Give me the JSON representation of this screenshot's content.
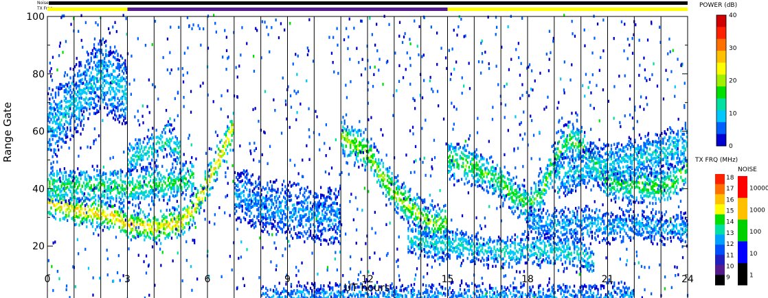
{
  "chart_data": {
    "type": "heatmap",
    "xlabel": "UT hours",
    "ylabel": "Range Gate",
    "xlim": [
      0,
      24
    ],
    "ylim": [
      0,
      100
    ],
    "x_ticks": [
      "0",
      "3",
      "6",
      "9",
      "12",
      "15",
      "18",
      "21",
      "24"
    ],
    "y_ticks": [
      "0",
      "20",
      "40",
      "60",
      "80",
      "100"
    ],
    "vertical_gridlines_hours": [
      1,
      2,
      3,
      4,
      5,
      6,
      7,
      8,
      9,
      10,
      11,
      12,
      13,
      14,
      15,
      16,
      17,
      18,
      19,
      20,
      21,
      22,
      23
    ],
    "noise_label": "Noise",
    "txfreq_label": "TX Freq",
    "tx_freq_segments": [
      {
        "start": 0,
        "end": 3,
        "color": "#ffff00"
      },
      {
        "start": 3,
        "end": 15,
        "color": "#551a8b"
      },
      {
        "start": 15,
        "end": 24,
        "color": "#ffff00"
      }
    ],
    "power_scale": {
      "title": "POWER (dB)",
      "ticks": [
        "40",
        "30",
        "20",
        "10",
        "0"
      ],
      "range": [
        0,
        40
      ],
      "colors": [
        "#0000d0",
        "#0060ff",
        "#00c8ff",
        "#00e0a0",
        "#00e000",
        "#a0f000",
        "#ffff00",
        "#ffc000",
        "#ff7000",
        "#ff2000",
        "#d00000"
      ]
    },
    "tx_freq_scale": {
      "title": "TX FRQ (MHz)",
      "ticks": [
        "18",
        "17",
        "16",
        "15",
        "14",
        "13",
        "12",
        "11",
        "10",
        "9"
      ],
      "colors": [
        "#000000",
        "#551a8b",
        "#2020c0",
        "#0050ff",
        "#00a0ff",
        "#00e0a0",
        "#00e000",
        "#ffff00",
        "#ffc000",
        "#ff7000",
        "#ff2000"
      ]
    },
    "noise_scale": {
      "title": "NOISE",
      "ticks": [
        "10000",
        "1000",
        "100",
        "10",
        "1"
      ],
      "colors": [
        "#000000",
        "#0000ff",
        "#00d000",
        "#ffc000",
        "#ff0000"
      ]
    },
    "echo_bands": [
      {
        "name": "",
        "points": [
          [
            0,
            35
          ],
          [
            1,
            32
          ],
          [
            2,
            31
          ],
          [
            2.5,
            30
          ],
          [
            3,
            27
          ],
          [
            4,
            26
          ],
          [
            5,
            28
          ],
          [
            5.5,
            33
          ],
          [
            6,
            42
          ],
          [
            6.5,
            52
          ],
          [
            7,
            62
          ]
        ],
        "power": 24,
        "width": 5
      },
      {
        "name": "",
        "points": [
          [
            0,
            41
          ],
          [
            2,
            40
          ],
          [
            3,
            40
          ],
          [
            4,
            41
          ],
          [
            5,
            42
          ],
          [
            5.5,
            44
          ]
        ],
        "power": 14,
        "width": 6
      },
      {
        "name": "",
        "points": [
          [
            3,
            50
          ],
          [
            4,
            54
          ],
          [
            4.5,
            57
          ],
          [
            5,
            52
          ]
        ],
        "power": 11,
        "width": 5
      },
      {
        "name": "",
        "points": [
          [
            7,
            38
          ],
          [
            8,
            34
          ],
          [
            9,
            32
          ],
          [
            10,
            30
          ],
          [
            11,
            30
          ]
        ],
        "power": 6,
        "width": 9
      },
      {
        "name": "",
        "points": [
          [
            11,
            58
          ],
          [
            12,
            52
          ],
          [
            12.5,
            44
          ],
          [
            13,
            38
          ],
          [
            13.5,
            34
          ],
          [
            14,
            30
          ],
          [
            14.5,
            27
          ],
          [
            15,
            28
          ]
        ],
        "power": 18,
        "width": 6
      },
      {
        "name": "",
        "points": [
          [
            13.5,
            22
          ],
          [
            14.5,
            20
          ],
          [
            15,
            20
          ],
          [
            16,
            19
          ],
          [
            17,
            18
          ],
          [
            18,
            18
          ],
          [
            19,
            18
          ],
          [
            20,
            17
          ],
          [
            20.5,
            14
          ]
        ],
        "power": 10,
        "width": 5
      },
      {
        "name": "",
        "points": [
          [
            15,
            50
          ],
          [
            16,
            47
          ],
          [
            17,
            42
          ],
          [
            17.5,
            37
          ],
          [
            18,
            34
          ],
          [
            18.5,
            38
          ],
          [
            19,
            50
          ],
          [
            19.5,
            57
          ],
          [
            20,
            55
          ],
          [
            20.5,
            48
          ],
          [
            21,
            42
          ],
          [
            22,
            41
          ],
          [
            23,
            40
          ],
          [
            23.5,
            42
          ],
          [
            24,
            48
          ]
        ],
        "power": 15,
        "width": 6
      },
      {
        "name": "",
        "points": [
          [
            18,
            28
          ],
          [
            19,
            27
          ],
          [
            20,
            28
          ],
          [
            21,
            26
          ],
          [
            22,
            27
          ],
          [
            23,
            26
          ],
          [
            24,
            25
          ]
        ],
        "power": 7,
        "width": 5
      },
      {
        "name": "",
        "points": [
          [
            8,
            2
          ],
          [
            10,
            2
          ],
          [
            12,
            2
          ],
          [
            14,
            2
          ],
          [
            16,
            2
          ],
          [
            18,
            2
          ],
          [
            20,
            2
          ],
          [
            22,
            2
          ]
        ],
        "power": 6,
        "width": 4
      },
      {
        "name": "",
        "points": [
          [
            0,
            60
          ],
          [
            1,
            70
          ],
          [
            2,
            80
          ],
          [
            3,
            72
          ]
        ],
        "power": 8,
        "width": 12
      },
      {
        "name": "",
        "points": [
          [
            19,
            44
          ],
          [
            21,
            48
          ],
          [
            23,
            52
          ],
          [
            24,
            55
          ]
        ],
        "power": 9,
        "width": 7
      }
    ]
  }
}
